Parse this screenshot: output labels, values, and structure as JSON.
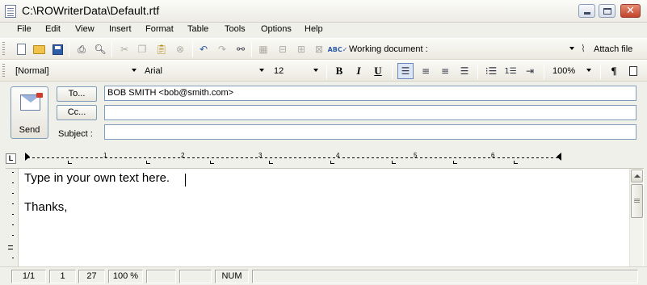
{
  "window": {
    "title": "C:\\ROWriterData\\Default.rtf"
  },
  "menu": [
    "File",
    "Edit",
    "View",
    "Insert",
    "Format",
    "Table",
    "Tools",
    "Options",
    "Help"
  ],
  "toolbar1": {
    "working_document_label": "Working document :",
    "working_document_value": "",
    "attach_label": "Attach file",
    "icons": [
      "new-document-icon",
      "open-folder-icon",
      "save-icon",
      "print-icon",
      "print-preview-icon",
      "cut-icon",
      "copy-icon",
      "paste-icon",
      "delete-icon",
      "undo-icon",
      "redo-icon",
      "find-icon",
      "table-icon",
      "insert-row-icon",
      "insert-col-icon",
      "delete-row-icon",
      "spellcheck-icon",
      "paperclip-icon"
    ]
  },
  "toolbar2": {
    "style": "[Normal]",
    "font": "Arial",
    "size": "12",
    "bold": "B",
    "italic": "I",
    "underline": "U",
    "zoom": "100%",
    "pilcrow": "¶",
    "active_alignment": "left"
  },
  "header": {
    "send_label": "Send",
    "to_button": "To...",
    "cc_button": "Cc...",
    "subject_label": "Subject :",
    "to_value": "BOB SMITH <bob@smith.com>",
    "cc_value": "",
    "subject_value": ""
  },
  "ruler": {
    "tab_button": "L",
    "numbers": [
      "1",
      "2",
      "3",
      "4",
      "5",
      "6"
    ]
  },
  "document": {
    "lines": [
      "Type in your own text here.",
      "",
      "Thanks,"
    ]
  },
  "status": {
    "page": "1/1",
    "line": "1",
    "column": "27",
    "zoom": "100 %",
    "blank1": "",
    "blank2": "",
    "num": "NUM",
    "message": ""
  }
}
